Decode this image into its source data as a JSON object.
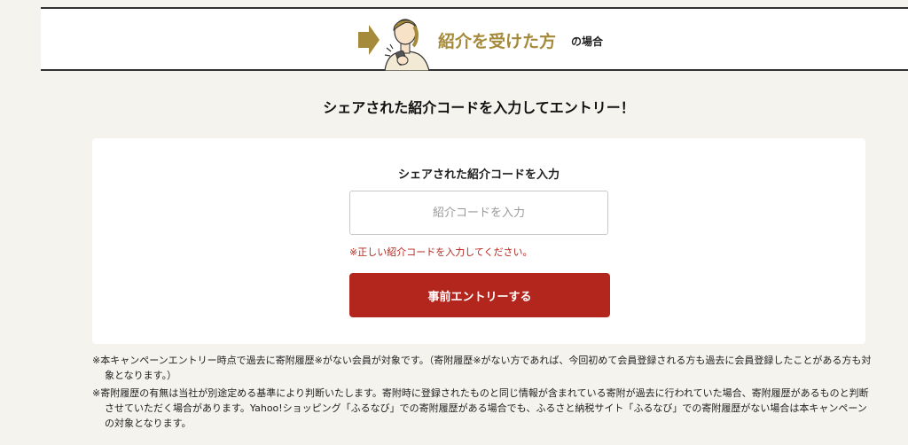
{
  "header": {
    "title": "紹介を受けた方",
    "suffix": "の場合",
    "accent_color": "#a58a3b",
    "icons": [
      "arrow-right-icon",
      "person-with-phone-icon"
    ]
  },
  "heading": "シェアされた紹介コードを入力してエントリー！",
  "form": {
    "label": "シェアされた紹介コードを入力",
    "input_value": "",
    "input_placeholder": "紹介コードを入力",
    "error": "※正しい紹介コードを入力してください。",
    "submit_label": "事前エントリーする",
    "button_color": "#b3261e"
  },
  "notes": [
    "※本キャンペーンエントリー時点で過去に寄附履歴※がない会員が対象です。（寄附履歴※がない方であれば、今回初めて会員登録される方も過去に会員登録したことがある方も対象となります。）",
    "※寄附履歴の有無は当社が別途定める基準により判断いたします。寄附時に登録されたものと同じ情報が含まれている寄附が過去に行われていた場合、寄附履歴があるものと判断させていただく場合があります。Yahoo!ショッピング「ふるなび」での寄附履歴がある場合でも、ふるさと納税サイト「ふるなび」での寄附履歴がない場合は本キャンペーンの対象となります。"
  ]
}
